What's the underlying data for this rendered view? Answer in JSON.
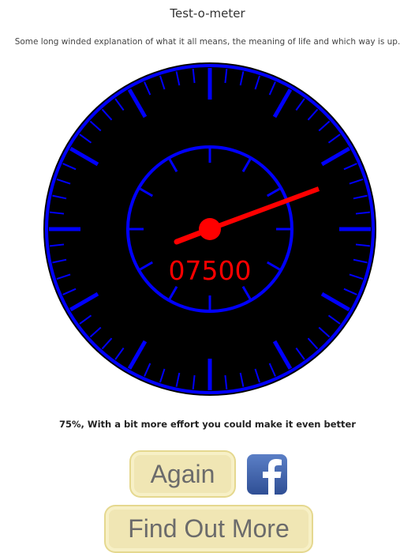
{
  "header": {
    "title": "Test-o-meter",
    "intro": "Some long winded explanation of what it all means, the meaning of life and which way is up."
  },
  "gauge": {
    "reading": "07500",
    "level_fraction": 0.75,
    "colors": {
      "face": "#000000",
      "ticks": "#0000ff",
      "needle": "#ff0000",
      "readout": "#ff0000"
    }
  },
  "result": {
    "text": "75%, With a bit more effort you could make it even better"
  },
  "actions": {
    "again_label": "Again",
    "find_out_more_label": "Find Out More",
    "share_icon": "facebook-icon",
    "button_color": "#f0e6b4"
  }
}
